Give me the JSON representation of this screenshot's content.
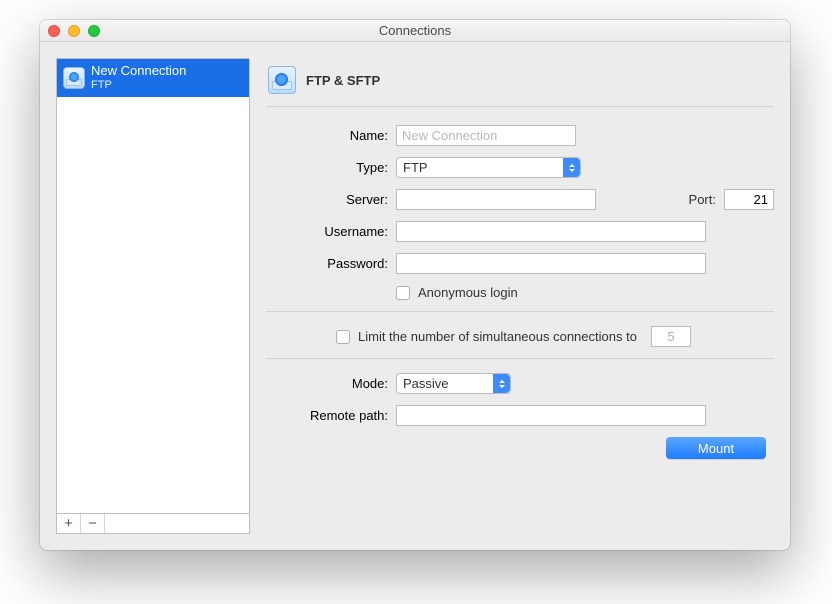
{
  "window": {
    "title": "Connections"
  },
  "sidebar": {
    "item": {
      "title": "New Connection",
      "subtitle": "FTP"
    },
    "add_glyph": "+",
    "remove_glyph": "−"
  },
  "section": {
    "title": "FTP & SFTP"
  },
  "labels": {
    "name": "Name:",
    "type": "Type:",
    "server": "Server:",
    "port": "Port:",
    "username": "Username:",
    "password": "Password:",
    "anonymous": "Anonymous login",
    "limit": "Limit the number of simultaneous connections to",
    "mode": "Mode:",
    "remote_path": "Remote path:"
  },
  "values": {
    "name_placeholder": "New Connection",
    "type": "FTP",
    "server": "",
    "port": "21",
    "username": "",
    "password": "",
    "limit_count": "5",
    "mode": "Passive",
    "remote_path": ""
  },
  "actions": {
    "mount": "Mount"
  }
}
